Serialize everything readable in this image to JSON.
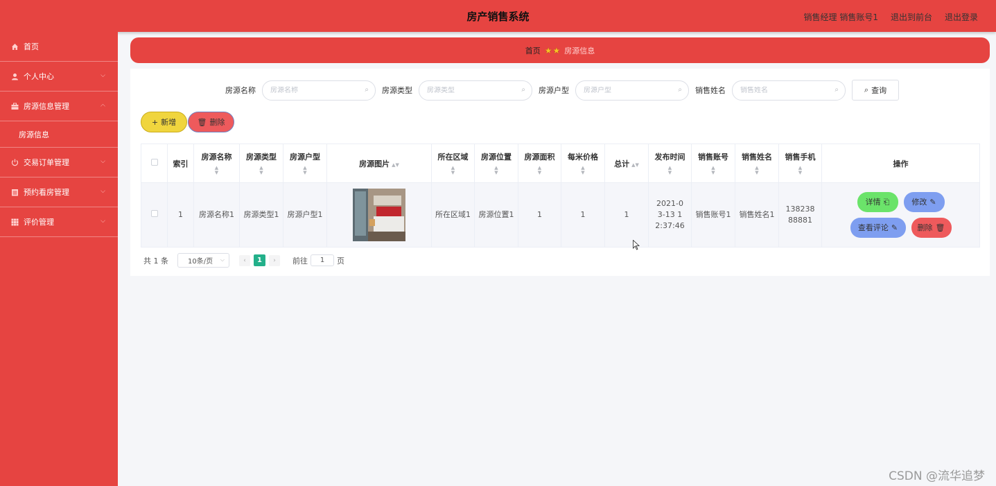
{
  "header": {
    "title": "房产销售系统",
    "user_info": "销售经理 销售账号1",
    "back_front": "退出到前台",
    "logout": "退出登录"
  },
  "sidebar": {
    "items": [
      {
        "label": "首页",
        "icon": "home-icon"
      },
      {
        "label": "个人中心",
        "icon": "user-icon"
      },
      {
        "label": "房源信息管理",
        "icon": "briefcase-icon"
      },
      {
        "label": "交易订单管理",
        "icon": "power-icon"
      },
      {
        "label": "预约看房管理",
        "icon": "calendar-icon"
      },
      {
        "label": "评价管理",
        "icon": "grid-icon"
      }
    ],
    "sub_item": "房源信息"
  },
  "breadcrumb": {
    "home": "首页",
    "current": "房源信息"
  },
  "search": {
    "fields": [
      {
        "label": "房源名称",
        "placeholder": "房源名称"
      },
      {
        "label": "房源类型",
        "placeholder": "房源类型"
      },
      {
        "label": "房源户型",
        "placeholder": "房源户型"
      },
      {
        "label": "销售姓名",
        "placeholder": "销售姓名"
      }
    ],
    "query_label": "查询"
  },
  "actions": {
    "add_label": "新增",
    "delete_label": "删除"
  },
  "table": {
    "headers": [
      "索引",
      "房源名称",
      "房源类型",
      "房源户型",
      "房源图片",
      "所在区域",
      "房源位置",
      "房源面积",
      "每米价格",
      "总计",
      "发布时间",
      "销售账号",
      "销售姓名",
      "销售手机",
      "操作"
    ],
    "rows": [
      {
        "index": "1",
        "name": "房源名称1",
        "type": "房源类型1",
        "layout": "房源户型1",
        "area_region": "所在区域1",
        "location": "房源位置1",
        "size": "1",
        "price_per_meter": "1",
        "total": "1",
        "publish_time": "2021-03-13 12:37:46",
        "sales_account": "销售账号1",
        "sales_name": "销售姓名1",
        "sales_phone": "13823888881"
      }
    ],
    "row_actions": {
      "detail": "详情",
      "edit": "修改",
      "review": "查看评论",
      "remove": "删除"
    }
  },
  "pagination": {
    "total_text": "共 1 条",
    "page_size": "10条/页",
    "current_page": "1",
    "goto_label": "前往",
    "goto_value": "1",
    "page_suffix": "页"
  },
  "watermark": "CSDN @流华追梦",
  "colors": {
    "primary_red": "#e64441",
    "add_yellow": "#f0d53e",
    "detail_green": "#6be36a",
    "edit_blue": "#7e9ef0",
    "page_active": "#23b08a"
  }
}
